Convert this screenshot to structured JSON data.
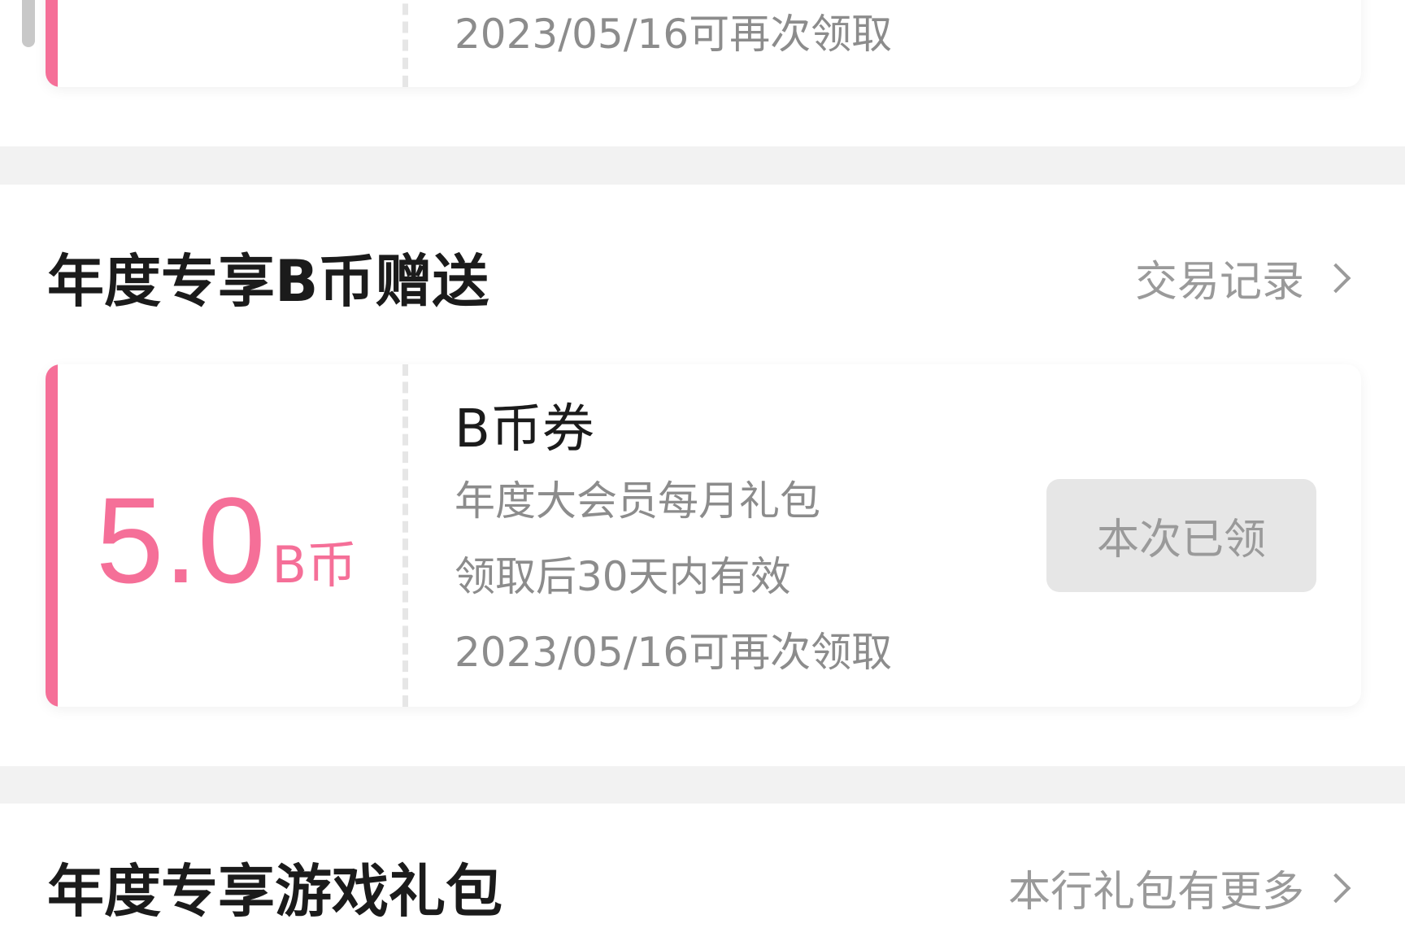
{
  "top_card": {
    "refresh_text": "2023/05/16可再次领取"
  },
  "bcoin_section": {
    "title": "年度专享B币赠送",
    "link_label": "交易记录",
    "coupon": {
      "amount": "5.0",
      "unit": "B币",
      "name": "B币券",
      "desc": "年度大会员每月礼包",
      "validity": "领取后30天内有效",
      "refresh_text": "2023/05/16可再次领取",
      "button_label": "本次已领"
    }
  },
  "game_section": {
    "title": "年度专享游戏礼包",
    "link_label": "本行礼包有更多"
  },
  "colors": {
    "accent": "#f56f98",
    "muted": "#8c8c8c",
    "disabled_bg": "#e6e6e6",
    "gap_bg": "#f2f2f2"
  }
}
